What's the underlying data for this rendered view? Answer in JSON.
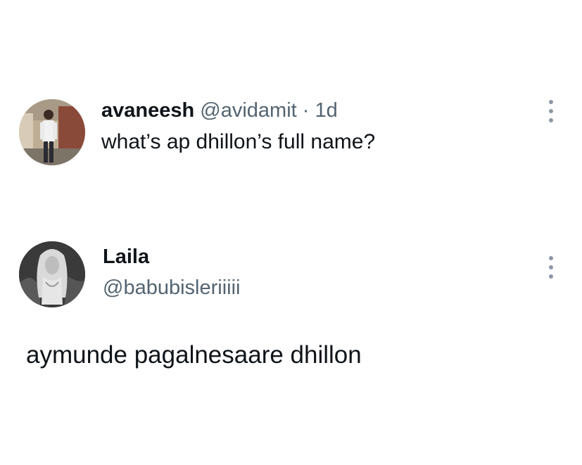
{
  "reply_tweet": {
    "display_name": "avaneesh",
    "handle": "@avidamit",
    "separator": "·",
    "timestamp": "1d",
    "text": "what’s ap dhillon’s full name?",
    "avatar_icon": "user-avatar-photo"
  },
  "answer_tweet": {
    "display_name": "Laila",
    "handle": "@babubisleriiiii",
    "text": "aymunde pagalnesaare dhillon",
    "avatar_icon": "user-avatar-bw-photo"
  },
  "icons": {
    "more": "more-vertical-icon"
  },
  "colors": {
    "text_primary": "#0f1419",
    "text_secondary": "#536471",
    "background": "#ffffff",
    "icon_muted": "#8b98a5"
  }
}
